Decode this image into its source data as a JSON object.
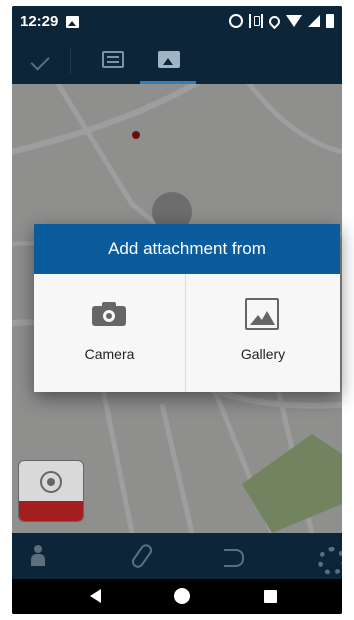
{
  "status_bar": {
    "time": "12:29",
    "icons": [
      "image-icon",
      "alarm-icon",
      "vibrate-icon",
      "location-icon",
      "wifi-icon",
      "signal-icon",
      "battery-icon"
    ]
  },
  "top_toolbar": {
    "icons": [
      "check-icon",
      "form-icon",
      "attachment-icon"
    ],
    "active_tab": "attachment"
  },
  "dialog": {
    "title": "Add attachment from",
    "options": [
      {
        "label": "Camera",
        "icon": "camera-icon"
      },
      {
        "label": "Gallery",
        "icon": "gallery-icon"
      }
    ]
  },
  "bottom_toolbar": {
    "icons": [
      "person-location-icon",
      "add-attachment-icon",
      "undo-icon",
      "settings-icon"
    ]
  },
  "nav_bar": {
    "icons": [
      "back-icon",
      "home-icon",
      "recents-icon"
    ]
  },
  "colors": {
    "toolbar": "#0c2538",
    "dialog_header": "#0b5c9c",
    "tab_indicator": "#2f7fb8",
    "locate_bar": "#a61d1d"
  }
}
